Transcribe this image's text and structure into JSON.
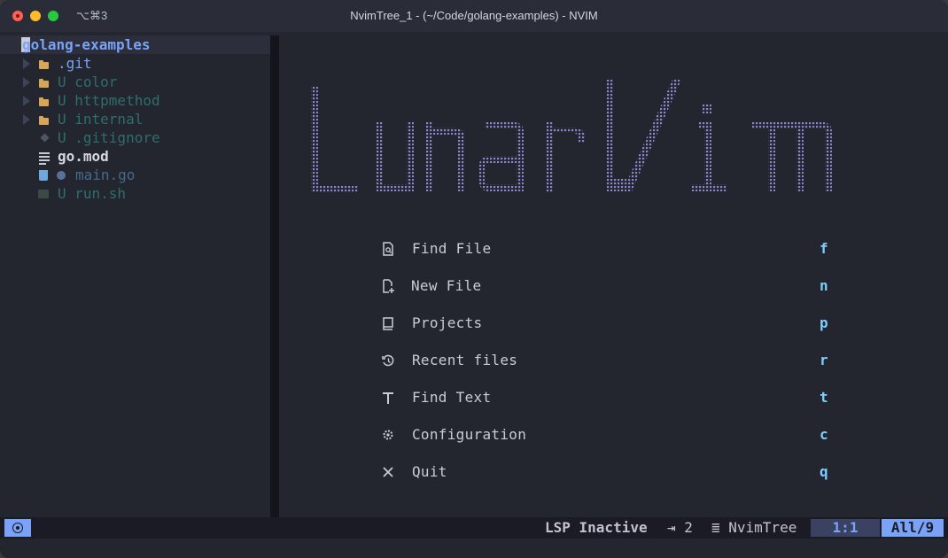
{
  "titlebar": {
    "shortcut": "⌥⌘3",
    "title": "NvimTree_1 - (~/Code/golang-examples) - NVIM"
  },
  "tree": {
    "root_label": "golang-examples",
    "items": [
      {
        "label": ".git",
        "status": "",
        "icon": "folder-icon"
      },
      {
        "label": "U color",
        "status": "U",
        "icon": "folder-icon"
      },
      {
        "label": "U httpmethod",
        "status": "U",
        "icon": "folder-icon"
      },
      {
        "label": "U internal",
        "status": "U",
        "icon": "folder-icon"
      },
      {
        "label": "U .gitignore",
        "status": "U",
        "icon": "git-icon"
      },
      {
        "label": "go.mod",
        "status": "",
        "icon": "file-lines-icon"
      },
      {
        "label": "main.go",
        "status": "",
        "icon": "go-gopher-icon"
      },
      {
        "label": "U run.sh",
        "status": "U",
        "icon": "terminal-icon"
      }
    ]
  },
  "dashboard": {
    "logo_text": "LunarVim",
    "menu": [
      {
        "icon": "search-file-icon",
        "label": "Find File",
        "key": "f"
      },
      {
        "icon": "new-file-icon",
        "label": "New File",
        "key": "n"
      },
      {
        "icon": "book-icon",
        "label": "Projects",
        "key": "p"
      },
      {
        "icon": "history-icon",
        "label": "Recent files",
        "key": "r"
      },
      {
        "icon": "text-icon",
        "label": "Find Text",
        "key": "t"
      },
      {
        "icon": "gear-icon",
        "label": "Configuration",
        "key": "c"
      },
      {
        "icon": "close-icon",
        "label": "Quit",
        "key": "q"
      }
    ]
  },
  "statusline": {
    "lsp": "LSP Inactive",
    "indent": "⇥ 2",
    "filetype": "≣ NvimTree",
    "position": "1:1",
    "progress": "All/9"
  },
  "colors": {
    "accent": "#7aa2f7",
    "background": "#23252f",
    "folder": "#d8a657",
    "untracked": "#2e6f6a",
    "logo": "#8c85c9"
  }
}
